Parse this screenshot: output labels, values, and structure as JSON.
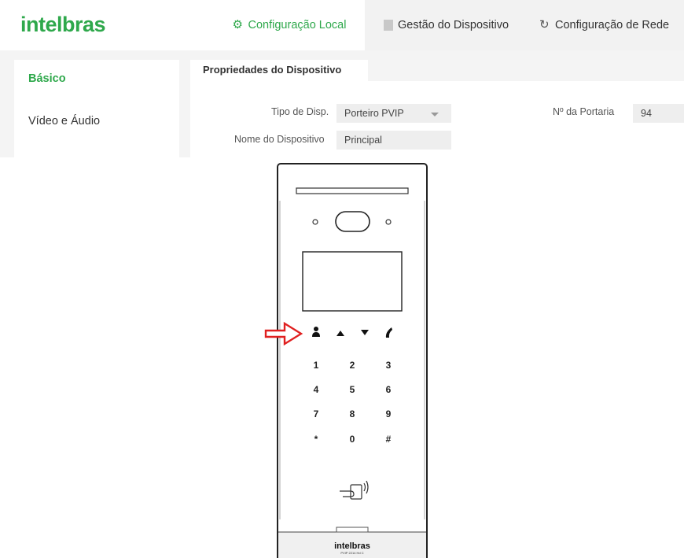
{
  "header": {
    "logo": "intelbras",
    "tabs": [
      {
        "label": "Configuração Local",
        "active": true,
        "icon": "gear-icon"
      },
      {
        "label": "Gestão do Dispositivo",
        "active": false,
        "icon": "device-icon"
      },
      {
        "label": "Configuração de Rede",
        "active": false,
        "icon": "network-icon"
      }
    ]
  },
  "sidebar": {
    "items": [
      {
        "label": "Básico",
        "active": true
      },
      {
        "label": "Vídeo e Áudio",
        "active": false
      }
    ]
  },
  "panel": {
    "tab_label": "Propriedades do Dispositivo",
    "fields": {
      "tipo": {
        "label": "Tipo de Disp.",
        "value": "Porteiro PVIP"
      },
      "nome": {
        "label": "Nome do Dispositivo",
        "value": "Principal"
      },
      "portaria": {
        "label": "Nº da Portaria",
        "value": "94"
      }
    }
  },
  "device": {
    "brand": "intelbras",
    "model": "PVIP 2214 Hd C",
    "keypad": [
      "1",
      "2",
      "3",
      "4",
      "5",
      "6",
      "7",
      "8",
      "9",
      "*",
      "0",
      "#"
    ],
    "function_keys": [
      "person-icon",
      "up-arrow-icon",
      "down-arrow-icon",
      "phone-icon"
    ],
    "highlighted_key": "person-icon"
  },
  "colors": {
    "brand_green": "#2ea84b",
    "arrow_red": "#e02020",
    "panel_bg": "#f4f4f4"
  }
}
